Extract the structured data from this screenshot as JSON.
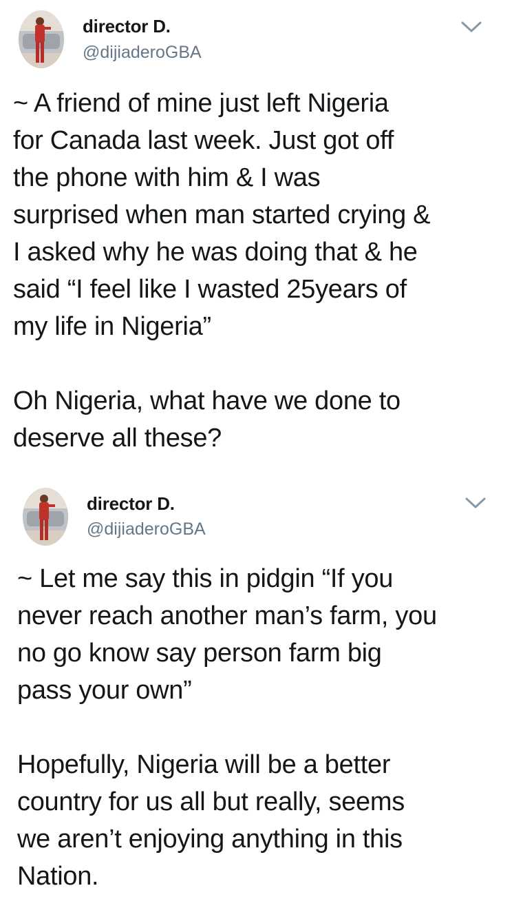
{
  "tweets": [
    {
      "author_name": "director D.",
      "author_handle": "@dijiaderoGBA",
      "menu_icon": "chevron-down-icon",
      "body_lines": [
        "~ A friend of mine just left Nigeria",
        "for Canada last week. Just got off",
        "the phone with him & I was",
        "surprised when man started crying &",
        "I asked why he was doing that & he",
        "said “I feel like I wasted 25years of",
        "my life in Nigeria”"
      ],
      "body_lines_2": [
        "Oh Nigeria, what have we done to",
        "deserve all these?"
      ]
    },
    {
      "author_name": "director D.",
      "author_handle": "@dijiaderoGBA",
      "menu_icon": "chevron-down-icon",
      "body_lines": [
        "~ Let me say this in pidgin “If you",
        "never reach another man’s farm, you",
        "no go know say person farm big",
        "pass your own”"
      ],
      "body_lines_2": [
        "Hopefully, Nigeria will be a better",
        "country for us all but really, seems",
        "we aren’t enjoying anything in this",
        "Nation."
      ]
    }
  ],
  "colors": {
    "text": "#14171a",
    "secondary": "#657786",
    "background": "#ffffff"
  }
}
